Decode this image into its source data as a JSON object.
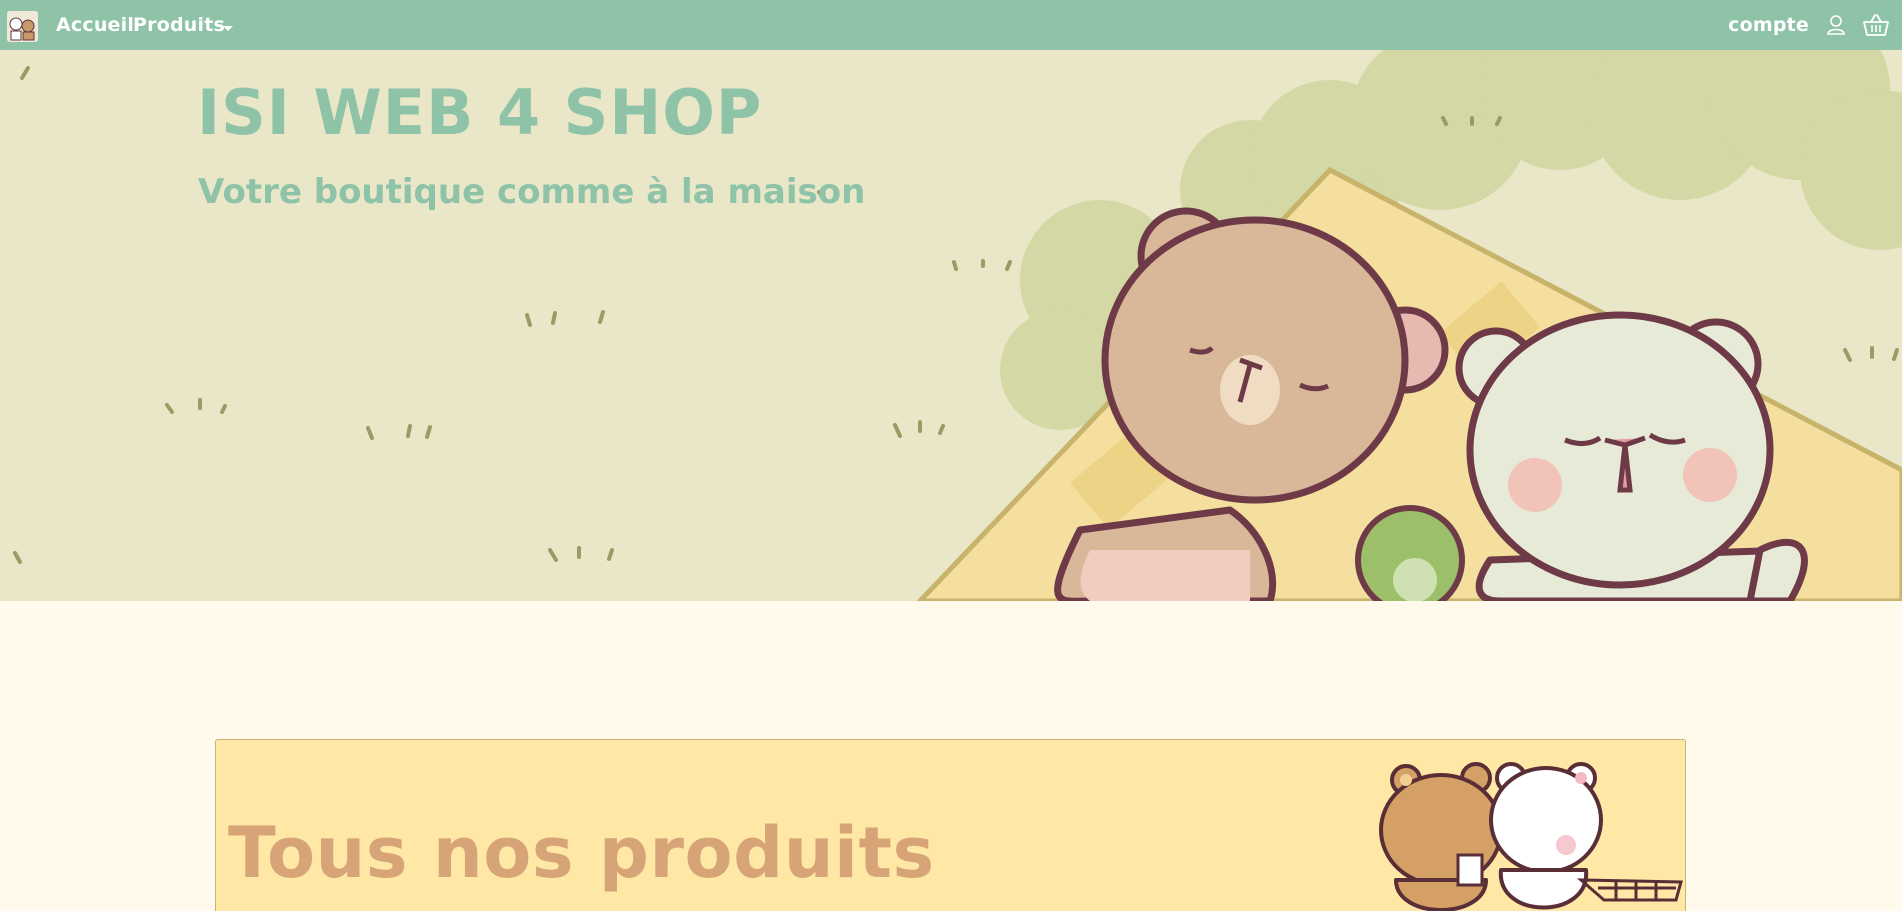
{
  "navbar": {
    "brand_icon": "bears-logo-icon",
    "accueil": "Accueil",
    "produits": "Produits",
    "compte": "compte",
    "user_icon": "user-icon",
    "basket_icon": "basket-icon"
  },
  "hero": {
    "title": "ISI WEB 4 SHOP",
    "subtitle": "Votre boutique comme à la maison"
  },
  "products": {
    "title": "Tous nos produits"
  },
  "colors": {
    "navbar": "#8ec3a8",
    "hero_bg": "#e9e7c8",
    "page_bg": "#fffaeb",
    "card_bg": "#ffe8a6",
    "card_title": "#d6a477"
  }
}
